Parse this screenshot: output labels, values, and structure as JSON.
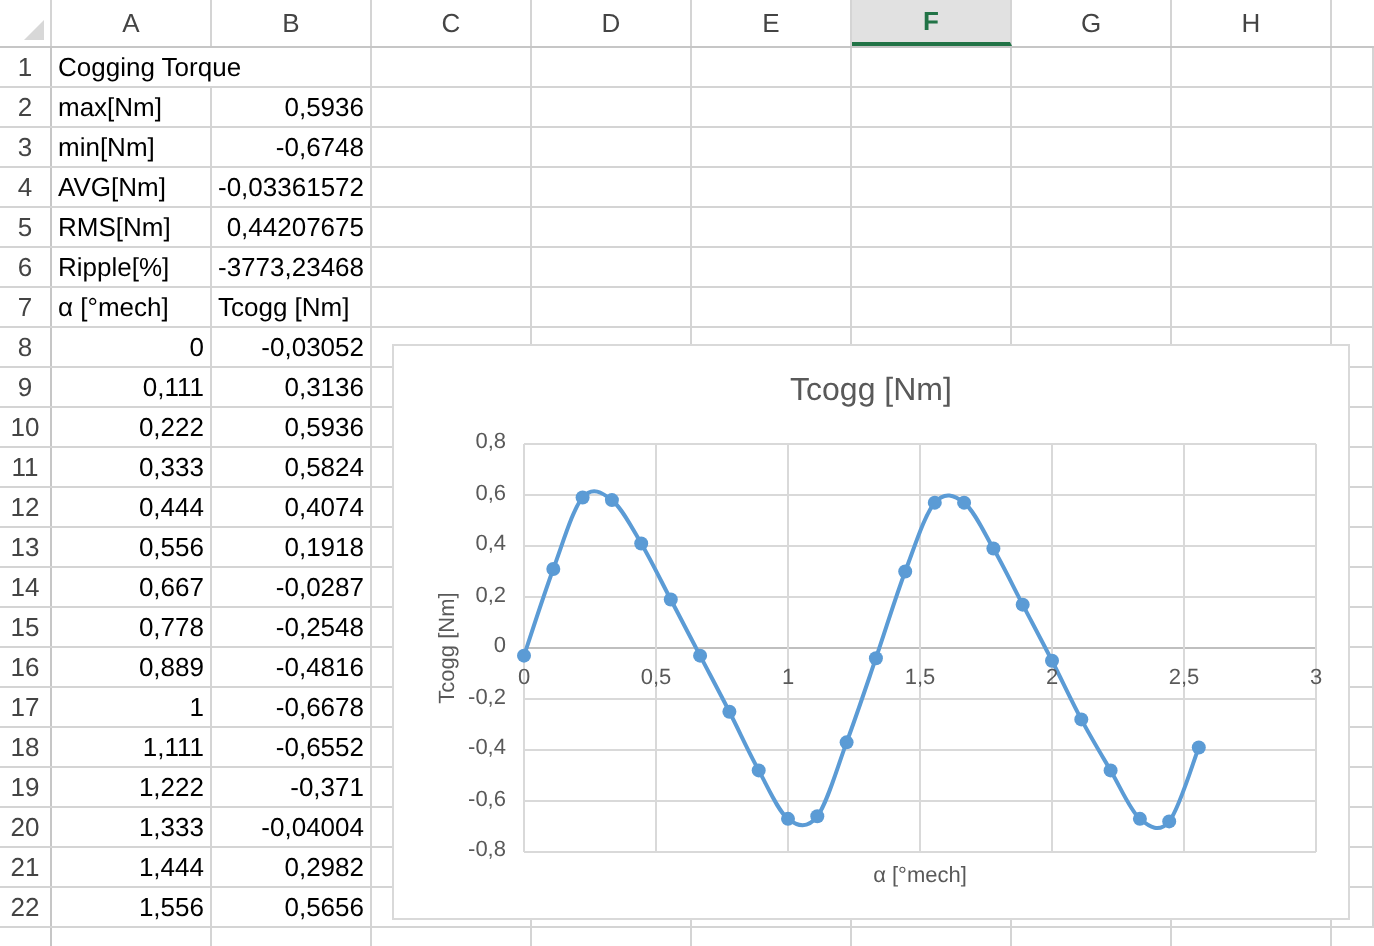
{
  "columns": [
    {
      "label": "A",
      "selected": false
    },
    {
      "label": "B",
      "selected": false
    },
    {
      "label": "C",
      "selected": false
    },
    {
      "label": "D",
      "selected": false
    },
    {
      "label": "E",
      "selected": false
    },
    {
      "label": "F",
      "selected": true
    },
    {
      "label": "G",
      "selected": false
    },
    {
      "label": "H",
      "selected": false
    }
  ],
  "rows": [
    {
      "number": "1",
      "cells": [
        {
          "text": "Cogging Torque",
          "kind": "text"
        }
      ]
    },
    {
      "number": "2",
      "cells": [
        {
          "text": "max[Nm]",
          "kind": "text"
        },
        {
          "text": "0,5936",
          "kind": "number"
        }
      ]
    },
    {
      "number": "3",
      "cells": [
        {
          "text": "min[Nm]",
          "kind": "text"
        },
        {
          "text": "-0,6748",
          "kind": "number"
        }
      ]
    },
    {
      "number": "4",
      "cells": [
        {
          "text": "AVG[Nm]",
          "kind": "text"
        },
        {
          "text": "-0,03361572",
          "kind": "number"
        }
      ]
    },
    {
      "number": "5",
      "cells": [
        {
          "text": "RMS[Nm]",
          "kind": "text"
        },
        {
          "text": "0,44207675",
          "kind": "number"
        }
      ]
    },
    {
      "number": "6",
      "cells": [
        {
          "text": "Ripple[%]",
          "kind": "text"
        },
        {
          "text": "-3773,23468",
          "kind": "number"
        }
      ]
    },
    {
      "number": "7",
      "cells": [
        {
          "text": "α [°mech]",
          "kind": "text"
        },
        {
          "text": "Tcogg [Nm]",
          "kind": "text"
        }
      ]
    },
    {
      "number": "8",
      "cells": [
        {
          "text": "0",
          "kind": "number"
        },
        {
          "text": "-0,03052",
          "kind": "number"
        }
      ]
    },
    {
      "number": "9",
      "cells": [
        {
          "text": "0,111",
          "kind": "number"
        },
        {
          "text": "0,3136",
          "kind": "number"
        }
      ]
    },
    {
      "number": "10",
      "cells": [
        {
          "text": "0,222",
          "kind": "number"
        },
        {
          "text": "0,5936",
          "kind": "number"
        }
      ]
    },
    {
      "number": "11",
      "cells": [
        {
          "text": "0,333",
          "kind": "number"
        },
        {
          "text": "0,5824",
          "kind": "number"
        }
      ]
    },
    {
      "number": "12",
      "cells": [
        {
          "text": "0,444",
          "kind": "number"
        },
        {
          "text": "0,4074",
          "kind": "number"
        }
      ]
    },
    {
      "number": "13",
      "cells": [
        {
          "text": "0,556",
          "kind": "number"
        },
        {
          "text": "0,1918",
          "kind": "number"
        }
      ]
    },
    {
      "number": "14",
      "cells": [
        {
          "text": "0,667",
          "kind": "number"
        },
        {
          "text": "-0,0287",
          "kind": "number"
        }
      ]
    },
    {
      "number": "15",
      "cells": [
        {
          "text": "0,778",
          "kind": "number"
        },
        {
          "text": "-0,2548",
          "kind": "number"
        }
      ]
    },
    {
      "number": "16",
      "cells": [
        {
          "text": "0,889",
          "kind": "number"
        },
        {
          "text": "-0,4816",
          "kind": "number"
        }
      ]
    },
    {
      "number": "17",
      "cells": [
        {
          "text": "1",
          "kind": "number"
        },
        {
          "text": "-0,6678",
          "kind": "number"
        }
      ]
    },
    {
      "number": "18",
      "cells": [
        {
          "text": "1,111",
          "kind": "number"
        },
        {
          "text": "-0,6552",
          "kind": "number"
        }
      ]
    },
    {
      "number": "19",
      "cells": [
        {
          "text": "1,222",
          "kind": "number"
        },
        {
          "text": "-0,371",
          "kind": "number"
        }
      ]
    },
    {
      "number": "20",
      "cells": [
        {
          "text": "1,333",
          "kind": "number"
        },
        {
          "text": "-0,04004",
          "kind": "number"
        }
      ]
    },
    {
      "number": "21",
      "cells": [
        {
          "text": "1,444",
          "kind": "number"
        },
        {
          "text": "0,2982",
          "kind": "number"
        }
      ]
    },
    {
      "number": "22",
      "cells": [
        {
          "text": "1,556",
          "kind": "number"
        },
        {
          "text": "0,5656",
          "kind": "number"
        }
      ]
    }
  ],
  "chart": {
    "chart_data": {
      "type": "line",
      "title": "Tcogg [Nm]",
      "xlabel": "α [°mech]",
      "ylabel": "Tcogg [Nm]",
      "x": [
        0,
        0.111,
        0.222,
        0.333,
        0.444,
        0.556,
        0.667,
        0.778,
        0.889,
        1,
        1.111,
        1.222,
        1.333,
        1.444,
        1.556,
        1.667,
        1.778,
        1.889,
        2,
        2.111,
        2.222,
        2.333,
        2.444,
        2.556
      ],
      "series": [
        {
          "color": "#5b9bd5",
          "marker": true,
          "values": [
            -0.03,
            0.31,
            0.59,
            0.58,
            0.41,
            0.19,
            -0.03,
            -0.25,
            -0.48,
            -0.67,
            -0.66,
            -0.37,
            -0.04,
            0.3,
            0.57,
            0.57,
            0.39,
            0.17,
            -0.05,
            -0.28,
            -0.48,
            -0.67,
            -0.68,
            -0.39
          ]
        }
      ],
      "grid": true,
      "xlim": [
        0,
        3
      ],
      "ylim": [
        -0.8,
        0.8
      ],
      "xticks": [
        {
          "value": 0,
          "label": "0"
        },
        {
          "value": 0.5,
          "label": "0,5"
        },
        {
          "value": 1,
          "label": "1"
        },
        {
          "value": 1.5,
          "label": "1,5"
        },
        {
          "value": 2,
          "label": "2"
        },
        {
          "value": 2.5,
          "label": "2,5"
        },
        {
          "value": 3,
          "label": "3"
        }
      ],
      "yticks": [
        {
          "value": 0.8,
          "label": "0,8"
        },
        {
          "value": 0.6,
          "label": "0,6"
        },
        {
          "value": 0.4,
          "label": "0,4"
        },
        {
          "value": 0.2,
          "label": "0,2"
        },
        {
          "value": 0,
          "label": "0"
        },
        {
          "value": -0.2,
          "label": "-0,2"
        },
        {
          "value": -0.4,
          "label": "-0,4"
        },
        {
          "value": -0.6,
          "label": "-0,6"
        },
        {
          "value": -0.8,
          "label": "-0,8"
        }
      ]
    }
  }
}
